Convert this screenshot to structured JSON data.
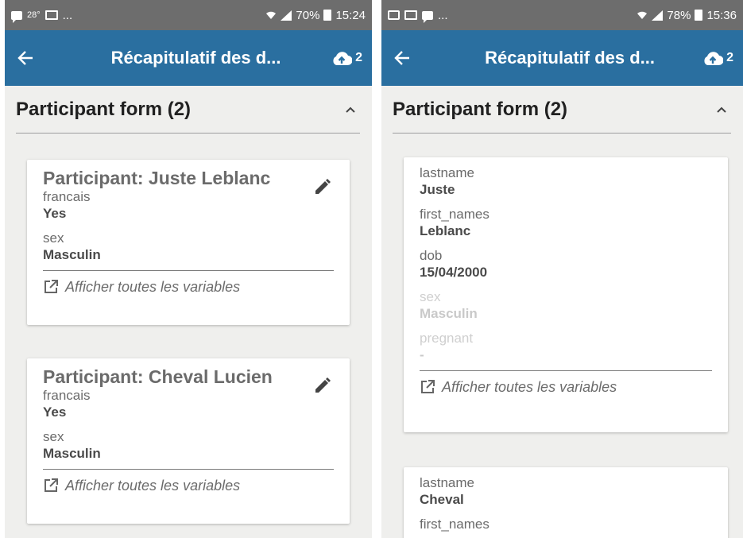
{
  "left": {
    "status": {
      "temp": "28°",
      "dots": "...",
      "battery": "70%",
      "time": "15:24"
    },
    "appbar": {
      "title": "Récapitulatif des d...",
      "upload_count": "2"
    },
    "section": {
      "title": "Participant form (2)"
    },
    "cards": [
      {
        "title": "Participant: Juste Leblanc",
        "fields": [
          {
            "label": "francais",
            "value": "Yes"
          },
          {
            "label": "sex",
            "value": "Masculin"
          }
        ],
        "show_all": "Afficher toutes les variables"
      },
      {
        "title": "Participant: Cheval Lucien",
        "fields": [
          {
            "label": "francais",
            "value": "Yes"
          },
          {
            "label": "sex",
            "value": "Masculin"
          }
        ],
        "show_all": "Afficher toutes les variables"
      }
    ]
  },
  "right": {
    "status": {
      "dots": "...",
      "battery": "78%",
      "time": "15:36"
    },
    "appbar": {
      "title": "Récapitulatif des d...",
      "upload_count": "2"
    },
    "section": {
      "title": "Participant form (2)"
    },
    "cards": [
      {
        "fields": [
          {
            "label": "lastname",
            "value": "Juste"
          },
          {
            "label": "first_names",
            "value": "Leblanc"
          },
          {
            "label": "dob",
            "value": "15/04/2000"
          },
          {
            "label": "sex",
            "value": "Masculin"
          },
          {
            "label": "pregnant",
            "value": "-"
          }
        ],
        "show_all": "Afficher toutes les variables"
      },
      {
        "fields": [
          {
            "label": "lastname",
            "value": "Cheval"
          },
          {
            "label": "first_names",
            "value": ""
          }
        ]
      }
    ]
  },
  "colors": {
    "appbar": "#2a6fa0",
    "statusbar": "#6d6d6d",
    "background": "#efefed"
  }
}
